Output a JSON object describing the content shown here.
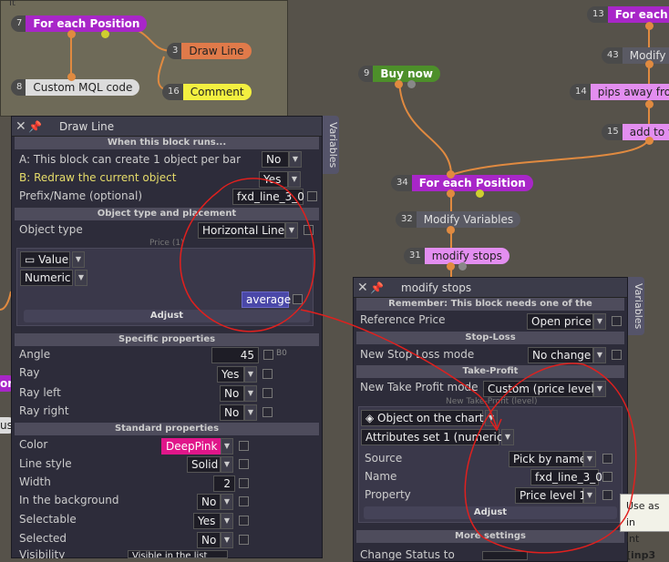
{
  "canvas": {
    "nodes": [
      {
        "num": "7",
        "label": "For each Position"
      },
      {
        "num": "3",
        "label": "Draw Line"
      },
      {
        "num": "8",
        "label": "Custom MQL code"
      },
      {
        "num": "16",
        "label": "Comment"
      },
      {
        "num": "9",
        "label": "Buy now"
      },
      {
        "num": "13",
        "label": "For each Po"
      },
      {
        "num": "43",
        "label": "Modify V"
      },
      {
        "num": "14",
        "label": "pips away from"
      },
      {
        "num": "15",
        "label": "add to v"
      },
      {
        "num": "34",
        "label": "For each Position"
      },
      {
        "num": "32",
        "label": "Modify Variables"
      },
      {
        "num": "31",
        "label": "modify stops"
      }
    ],
    "edge_labels": {
      "left1": "or",
      "left2": "us",
      "top_k": "It"
    }
  },
  "draw_line_panel": {
    "title": "Draw Line",
    "side_tab": "Variables",
    "sections": {
      "when_runs": "When this block runs...",
      "object_type": "Object type and placement",
      "specific": "Specific properties",
      "standard": "Standard properties"
    },
    "rows": {
      "a_label": "A: This block can create 1 object per bar",
      "a_value": "No",
      "b_label": "B: Redraw the current object",
      "b_value": "Yes",
      "prefix_label": "Prefix/Name (optional)",
      "prefix_value": "fxd_line_3_0",
      "object_type_label": "Object type",
      "object_type_value": "Horizontal Line",
      "price_caption": "Price (1)",
      "value_mode": "Value",
      "value_type": "Numeric",
      "value_input": "average",
      "adjust": "Adjust",
      "angle_label": "Angle",
      "angle_value": "45",
      "angle_suffix": "B0",
      "ray_label": "Ray",
      "ray_value": "Yes",
      "ray_left_label": "Ray left",
      "ray_left_value": "No",
      "ray_right_label": "Ray right",
      "ray_right_value": "No",
      "color_label": "Color",
      "color_value": "DeepPink",
      "line_style_label": "Line style",
      "line_style_value": "Solid",
      "width_label": "Width",
      "width_value": "2",
      "background_label": "In the background",
      "background_value": "No",
      "selectable_label": "Selectable",
      "selectable_value": "Yes",
      "selected_label": "Selected",
      "selected_value": "No",
      "visibility_label": "Visibility",
      "visibility_value": "Visible in the list"
    }
  },
  "modify_stops_panel": {
    "title": "modify stops",
    "side_tab": "Variables",
    "sections": {
      "remember": "Remember: This block needs one of the",
      "stop_loss": "Stop-Loss",
      "take_profit": "Take-Profit",
      "more": "More settings"
    },
    "rows": {
      "reference_label": "Reference Price",
      "reference_value": "Open price",
      "new_sl_label": "New Stop Loss mode",
      "new_sl_value": "No change",
      "new_tp_label": "New Take Profit mode",
      "new_tp_value": "Custom (price level)",
      "tp_level_caption": "New Take-Profit (level)",
      "object_on_chart": "Object on the chart",
      "attributes": "Attributes set 1 (numeric)",
      "source_label": "Source",
      "source_value": "Pick by name",
      "name_label": "Name",
      "name_value": "fxd_line_3_0",
      "property_label": "Property",
      "property_value": "Price level 1",
      "adjust": "Adjust",
      "change_status": "Change Status to"
    }
  },
  "tooltip": {
    "line1": "Use as in",
    "line2a": "int ",
    "line2b": "[inp3"
  },
  "colors": {
    "annotation": "#e0201e",
    "node_purple": "#a826c8",
    "deep_pink": "#e0168a"
  }
}
